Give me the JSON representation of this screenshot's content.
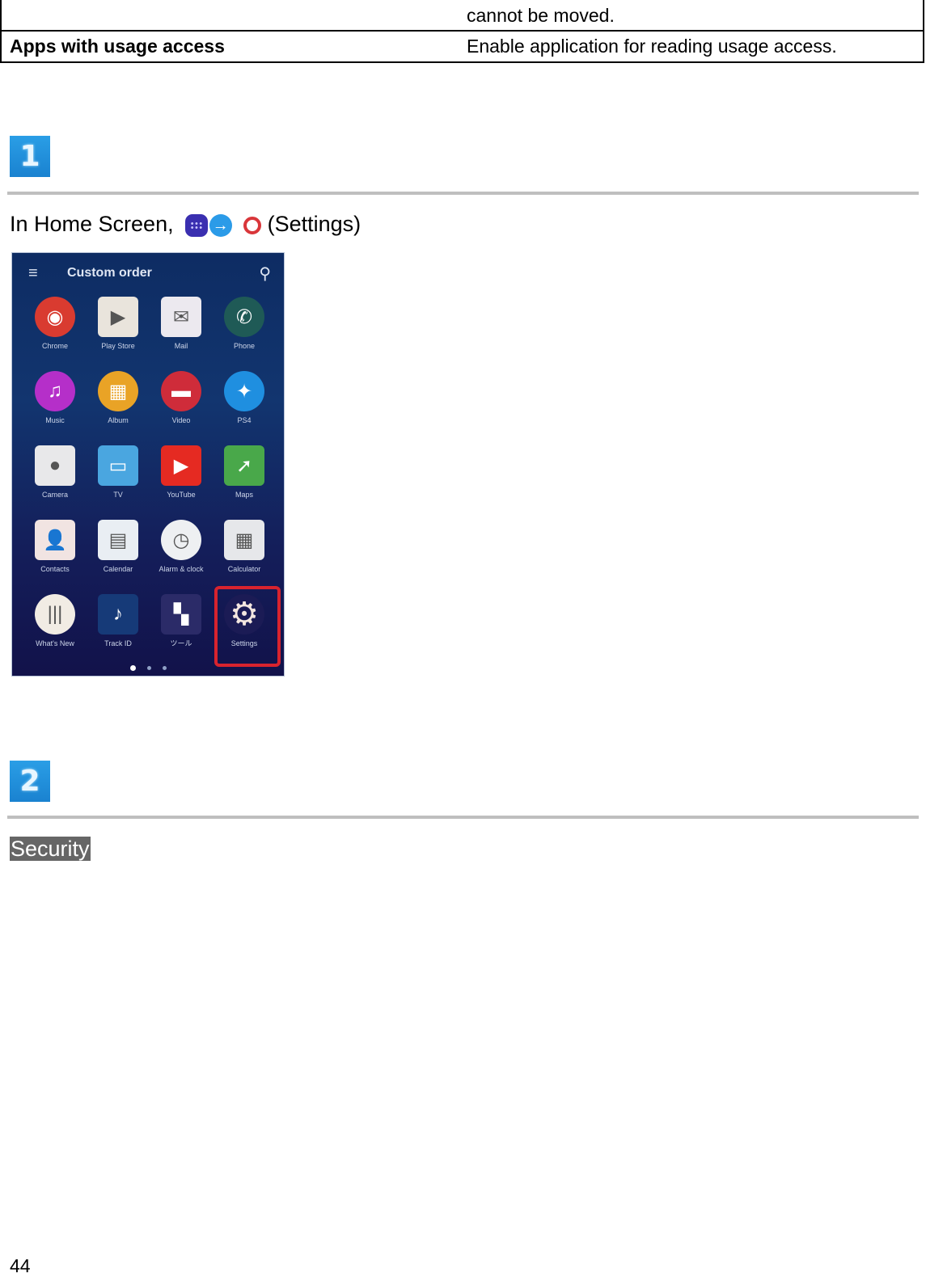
{
  "table": {
    "rows": [
      {
        "label": "",
        "description": "cannot be moved."
      },
      {
        "label": "Apps with usage access",
        "description": "Enable application for reading usage access."
      }
    ]
  },
  "steps": [
    {
      "number": "1",
      "text_before": "In Home Screen,",
      "icons": [
        "apps-icon",
        "arrow-right-icon",
        "settings-icon"
      ],
      "text_after": "(Settings)"
    },
    {
      "number": "2",
      "highlight_label": "Security"
    }
  ],
  "phone": {
    "title": "Custom order",
    "menu_icon": "≡",
    "search_icon": "⚲",
    "apps": [
      {
        "label": "Chrome",
        "icon": "chrome-icon",
        "glyph": "◉",
        "color": "#d93b30",
        "shape": "circle"
      },
      {
        "label": "Play Store",
        "icon": "play-store-icon",
        "glyph": "▶",
        "color": "#e9e4dc",
        "shape": "square"
      },
      {
        "label": "Mail",
        "icon": "mail-icon",
        "glyph": "✉",
        "color": "#ece9ef",
        "shape": "square"
      },
      {
        "label": "Phone",
        "icon": "phone-icon",
        "glyph": "✆",
        "color": "#1f5a56",
        "shape": "circle"
      },
      {
        "label": "Music",
        "icon": "music-icon",
        "glyph": "♫",
        "color": "#b52fc9",
        "shape": "circle"
      },
      {
        "label": "Album",
        "icon": "album-icon",
        "glyph": "▦",
        "color": "#e9a326",
        "shape": "circle"
      },
      {
        "label": "Video",
        "icon": "video-icon",
        "glyph": "▬",
        "color": "#cf2c3a",
        "shape": "circle"
      },
      {
        "label": "PS4",
        "icon": "playstation-icon",
        "glyph": "✦",
        "color": "#1f8fe0",
        "shape": "circle"
      },
      {
        "label": "Camera",
        "icon": "camera-icon",
        "glyph": "●",
        "color": "#e8e8ea",
        "shape": "square"
      },
      {
        "label": "TV",
        "icon": "tv-icon",
        "glyph": "▭",
        "color": "#4aa6e0",
        "shape": "square"
      },
      {
        "label": "YouTube",
        "icon": "youtube-icon",
        "glyph": "▶",
        "color": "#e52a22",
        "shape": "square"
      },
      {
        "label": "Maps",
        "icon": "maps-icon",
        "glyph": "➚",
        "color": "#49a84a",
        "shape": "square"
      },
      {
        "label": "Contacts",
        "icon": "contacts-icon",
        "glyph": "👤",
        "color": "#f1e4e2",
        "shape": "square"
      },
      {
        "label": "Calendar",
        "icon": "calendar-icon",
        "glyph": "▤",
        "color": "#e9eef3",
        "shape": "square"
      },
      {
        "label": "Alarm & clock",
        "icon": "clock-icon",
        "glyph": "◷",
        "color": "#eef0f2",
        "shape": "circle"
      },
      {
        "label": "Calculator",
        "icon": "calculator-icon",
        "glyph": "▦",
        "color": "#e6e7ea",
        "shape": "square"
      },
      {
        "label": "What's New",
        "icon": "whats-new-icon",
        "glyph": "|||",
        "color": "#f1ece4",
        "shape": "circle"
      },
      {
        "label": "Track ID",
        "icon": "track-id-icon",
        "glyph": "♪",
        "color": "#163a78",
        "shape": "square"
      },
      {
        "label": "ツール",
        "icon": "folder-icon",
        "glyph": "▚",
        "color": "#2b2b68",
        "shape": "square"
      },
      {
        "label": "Settings",
        "icon": "settings-gear-icon",
        "glyph": "⚙",
        "color": "#1b1b55",
        "shape": "circle",
        "highlighted": true
      }
    ],
    "page_dots": 3,
    "active_dot": 0
  },
  "footer": {
    "page_number": "44"
  }
}
